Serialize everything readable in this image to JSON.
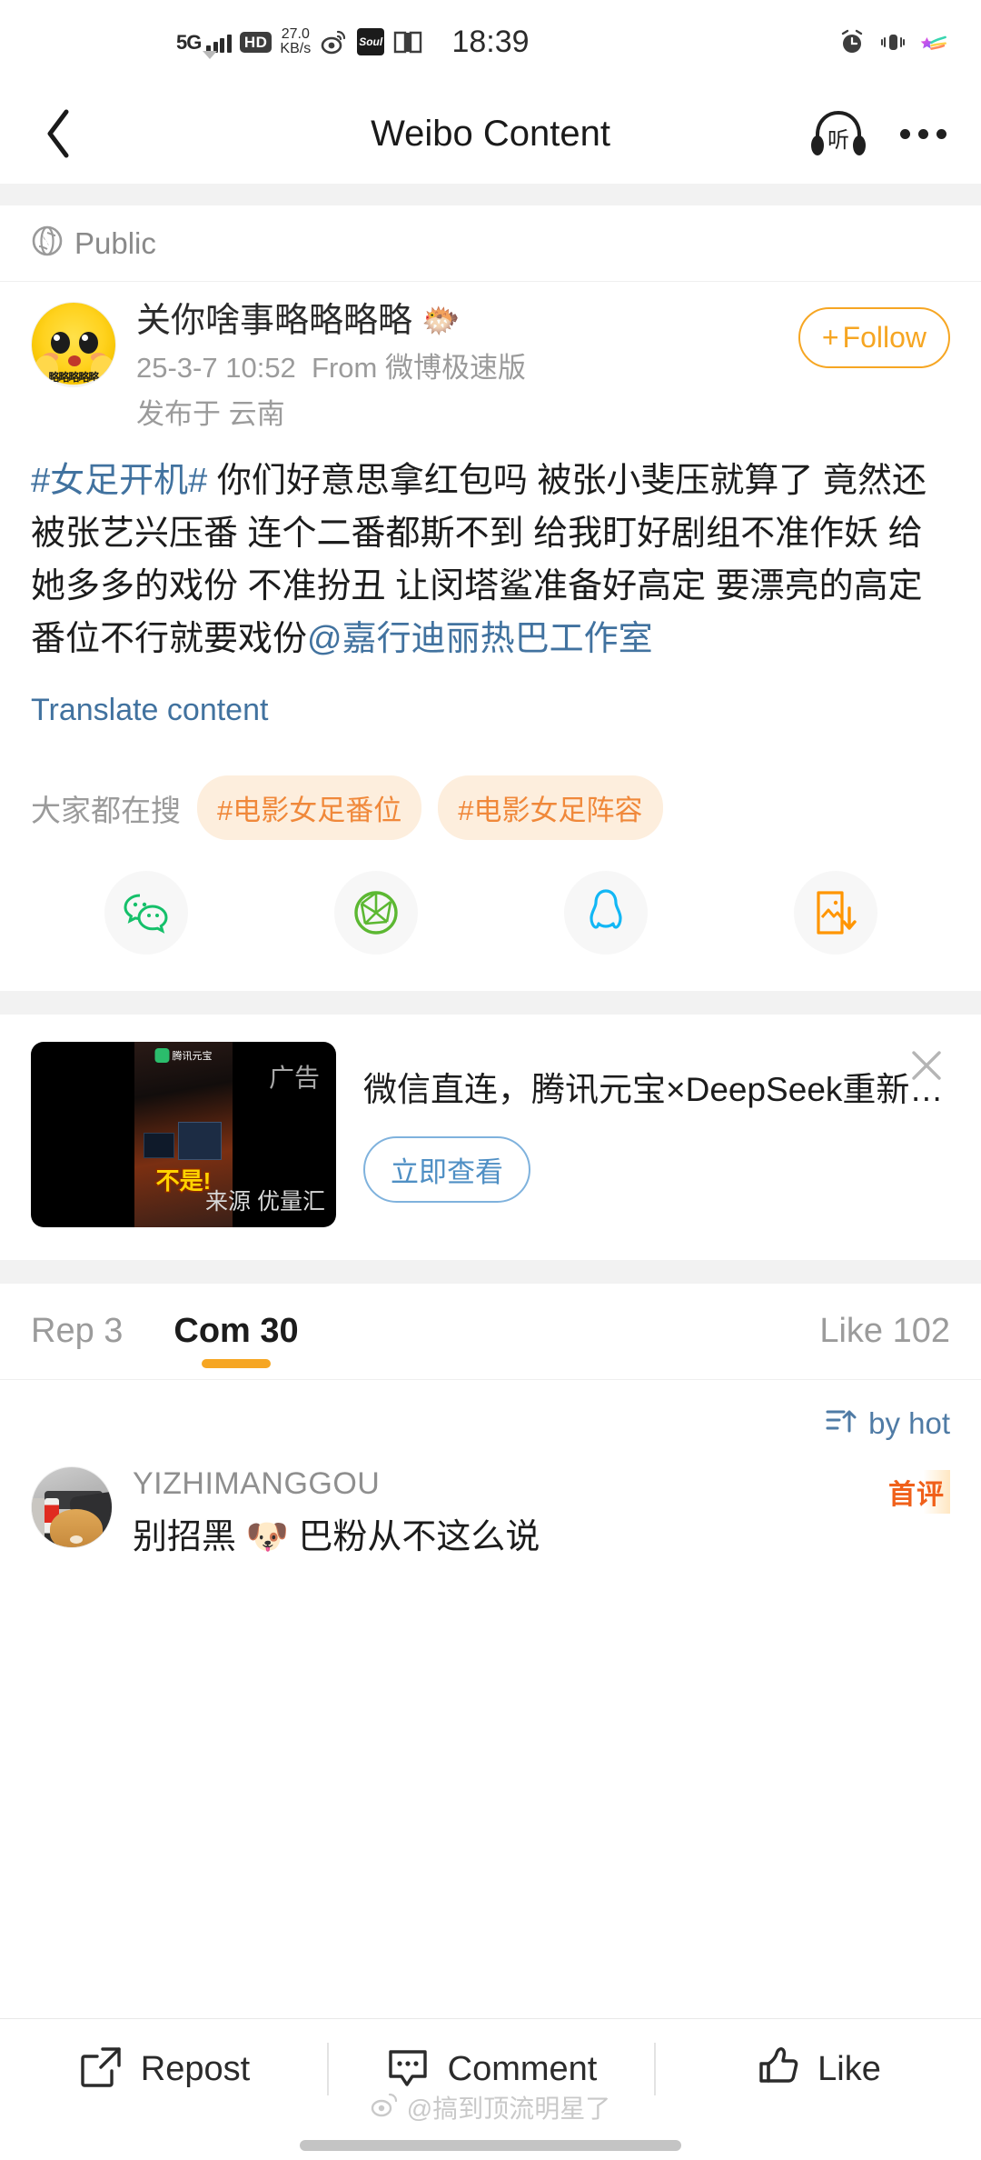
{
  "status_bar": {
    "network": "5G",
    "hd": "HD",
    "speed_value": "27.0",
    "speed_unit": "KB/s",
    "time": "18:39",
    "icons": [
      "weibo-icon",
      "soul-icon",
      "book-icon",
      "alarm-icon",
      "vibrate-icon",
      "rainbow-icon"
    ],
    "soul_label": "Soul"
  },
  "nav": {
    "back": "back-chevron",
    "title": "Weibo Content",
    "listen_label": "听",
    "more": "more-options"
  },
  "visibility": {
    "label": "Public",
    "icon": "globe-icon"
  },
  "post": {
    "author": {
      "name": "关你啥事略略略略",
      "name_emoji": "🐡",
      "avatar_caption": "略略略略略"
    },
    "timestamp": "25-3-7 10:52",
    "from_prefix": "From",
    "source": "微博极速版",
    "location": "发布于 云南",
    "follow_label": "Follow",
    "follow_plus": "+",
    "body": {
      "hashtag": "#女足开机#",
      "text": " 你们好意思拿红包吗 被张小斐压就算了 竟然还被张艺兴压番 连个二番都斯不到 给我盯好剧组不准作妖 给她多多的戏份 不准扮丑 让闵塔鲨准备好高定 要漂亮的高定 番位不行就要戏份",
      "mention": "@嘉行迪丽热巴工作室"
    },
    "translate_label": "Translate content"
  },
  "trends": {
    "label": "大家都在搜",
    "chips": [
      "#电影女足番位",
      "#电影女足阵容"
    ]
  },
  "share": {
    "items": [
      {
        "name": "wechat-icon",
        "color": "#15c06a"
      },
      {
        "name": "wechat-moments-icon",
        "color": "#5cb832"
      },
      {
        "name": "qq-icon",
        "color": "#12b7f5"
      },
      {
        "name": "save-image-icon",
        "color": "#ff9500"
      }
    ]
  },
  "ad": {
    "brand": "腾讯元宝",
    "badge": "广告",
    "overlay_text": "不是!",
    "source": "来源 优量汇",
    "title": "微信直连，腾讯元宝×DeepSeek重新…",
    "cta": "立即查看",
    "close": "close-icon"
  },
  "tabs": [
    {
      "label": "Rep 3",
      "active": false
    },
    {
      "label": "Com 30",
      "active": true
    },
    {
      "label": "Like 102",
      "active": false
    }
  ],
  "sort": {
    "label": "by hot",
    "icon": "sort-icon"
  },
  "comments": [
    {
      "author": "YIZHIMANGGOU",
      "text": "别招黑 🐶 巴粉从不这么说",
      "badge": "首评"
    }
  ],
  "bottom_bar": {
    "repost": "Repost",
    "comment": "Comment",
    "like": "Like"
  },
  "watermark": "@搞到顶流明星了",
  "colors": {
    "accent_orange": "#f6a623",
    "link_blue": "#41729f",
    "chip_bg": "#fdeedd",
    "chip_text": "#f0883a"
  }
}
